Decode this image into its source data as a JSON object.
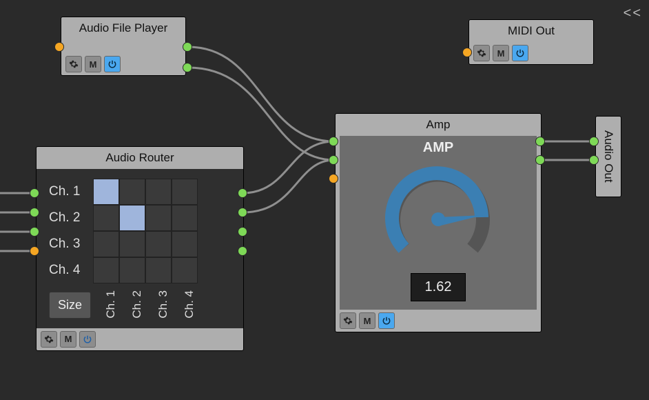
{
  "canvas": {
    "collapse_label": "<<"
  },
  "nodes": {
    "audio_file_player": {
      "title": "Audio File Player",
      "mute_label": "M"
    },
    "midi_out": {
      "title": "MIDI Out",
      "mute_label": "M"
    },
    "audio_router": {
      "title": "Audio Router",
      "size_button": "Size",
      "mute_label": "M",
      "rows": [
        "Ch. 1",
        "Ch. 2",
        "Ch. 3",
        "Ch. 4"
      ],
      "cols": [
        "Ch. 1",
        "Ch. 2",
        "Ch. 3",
        "Ch. 4"
      ],
      "active_cells": [
        [
          0,
          0
        ],
        [
          1,
          1
        ]
      ]
    },
    "amp": {
      "title": "Amp",
      "knob_label": "AMP",
      "value": "1.62",
      "mute_label": "M"
    },
    "audio_out": {
      "title": "Audio Out"
    }
  }
}
